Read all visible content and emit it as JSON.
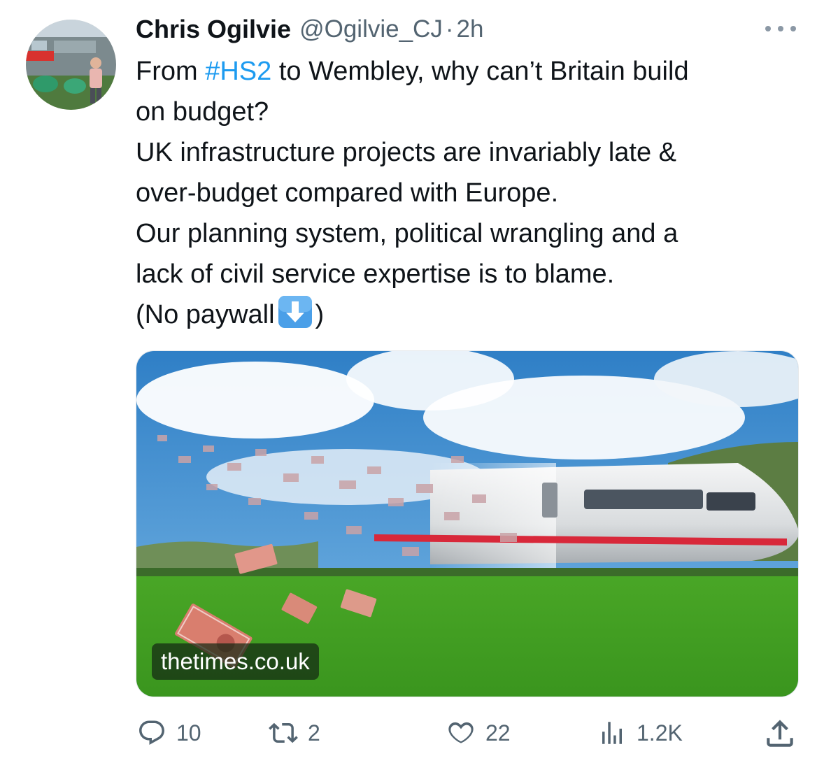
{
  "tweet": {
    "author": {
      "display_name": "Chris Ogilvie",
      "handle": "@Ogilvie_CJ",
      "separator": "·",
      "time": "2h"
    },
    "text": {
      "line1_before": "From ",
      "hashtag": "#HS2",
      "line1_after": " to Wembley, why can’t Britain build",
      "line2": "on budget?",
      "line3": "UK infrastructure projects are invariably late &",
      "line4": "over-budget compared with Europe.",
      "line5": "Our planning system, political wrangling and a",
      "line6": "lack of civil service expertise is to blame.",
      "line7_before": "(No paywall",
      "line7_after": ")"
    },
    "card": {
      "source": "thetimes.co.uk"
    },
    "actions": {
      "replies": "10",
      "reposts": "2",
      "likes": "22",
      "views": "1.2K"
    }
  },
  "colors": {
    "link": "#1d9bf0",
    "secondary_text": "#536471",
    "primary_text": "#0f1419"
  },
  "icons": [
    "more-icon",
    "down-arrow-emoji",
    "reply-icon",
    "repost-icon",
    "like-icon",
    "views-icon",
    "share-icon"
  ]
}
